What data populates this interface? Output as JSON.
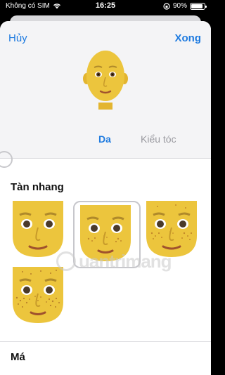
{
  "status_bar": {
    "carrier": "Không có SIM",
    "time": "16:25",
    "battery": "90%",
    "battery_level": 0.9
  },
  "header": {
    "cancel_label": "Hủy",
    "done_label": "Xong"
  },
  "tabs": [
    {
      "label": "Da",
      "active": true
    },
    {
      "label": "Kiểu tóc",
      "active": false
    }
  ],
  "sections": {
    "freckles_title": "Tàn nhang",
    "cheeks_title": "Má"
  },
  "freckle_options": [
    {
      "name": "none",
      "selected": false
    },
    {
      "name": "light",
      "selected": true
    },
    {
      "name": "medium",
      "selected": false
    },
    {
      "name": "heavy",
      "selected": false
    }
  ],
  "watermark": "uantrimang",
  "colors": {
    "accent": "#1f7be0",
    "skin": "#e9c23c",
    "sheet_bg": "#f4f4f6"
  }
}
